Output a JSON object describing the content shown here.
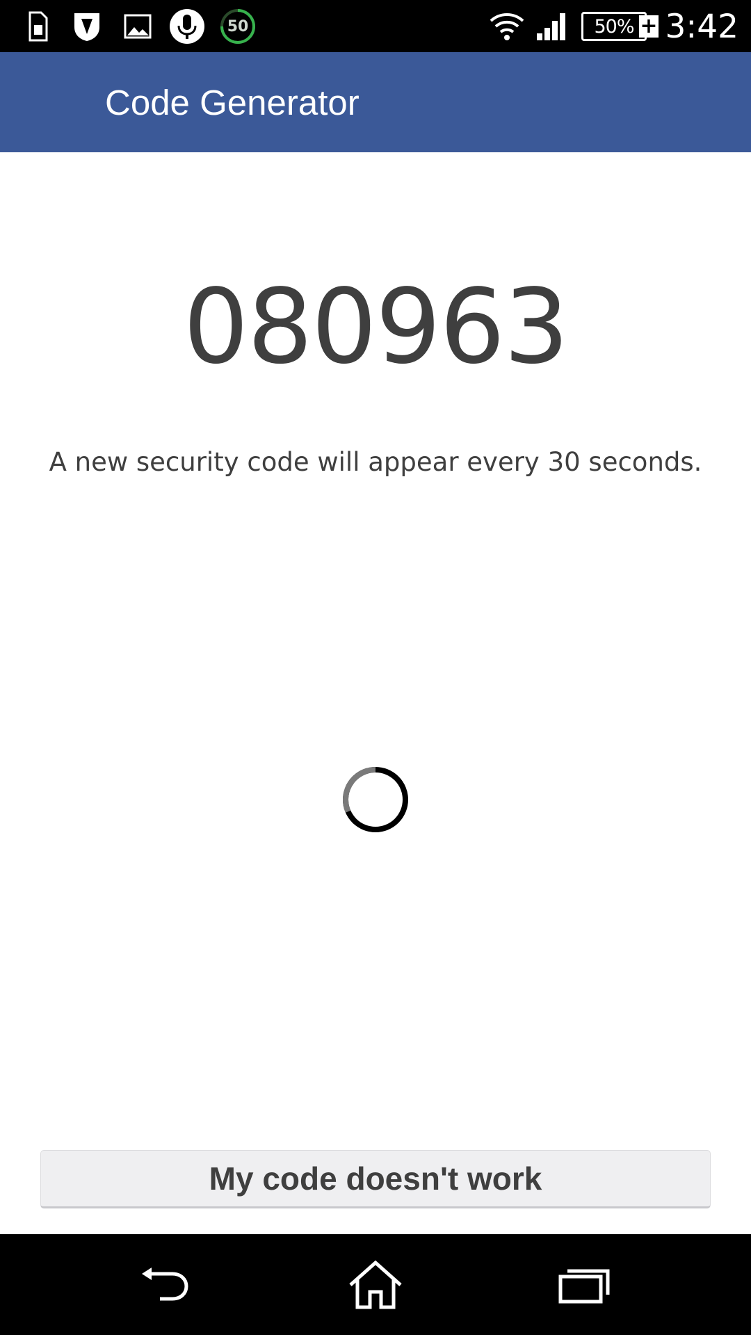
{
  "status_bar": {
    "icons": [
      "sim-card-icon",
      "shield-icon",
      "image-icon",
      "microphone-icon",
      "timer-badge-icon"
    ],
    "badge_value": "50",
    "right_icons": [
      "wifi-icon",
      "signal-icon",
      "battery-icon"
    ],
    "battery_level": "50%",
    "time": "3:42"
  },
  "app_bar": {
    "title": "Code Generator",
    "background_color": "#3b5998"
  },
  "main": {
    "security_code": "080963",
    "description": "A new security code will appear every 30 seconds.",
    "timer_icon": "progress-ring-icon"
  },
  "actions": {
    "code_not_working_label": "My code doesn't work"
  },
  "nav_bar": {
    "items": [
      "back-icon",
      "home-icon",
      "recent-apps-icon"
    ]
  }
}
